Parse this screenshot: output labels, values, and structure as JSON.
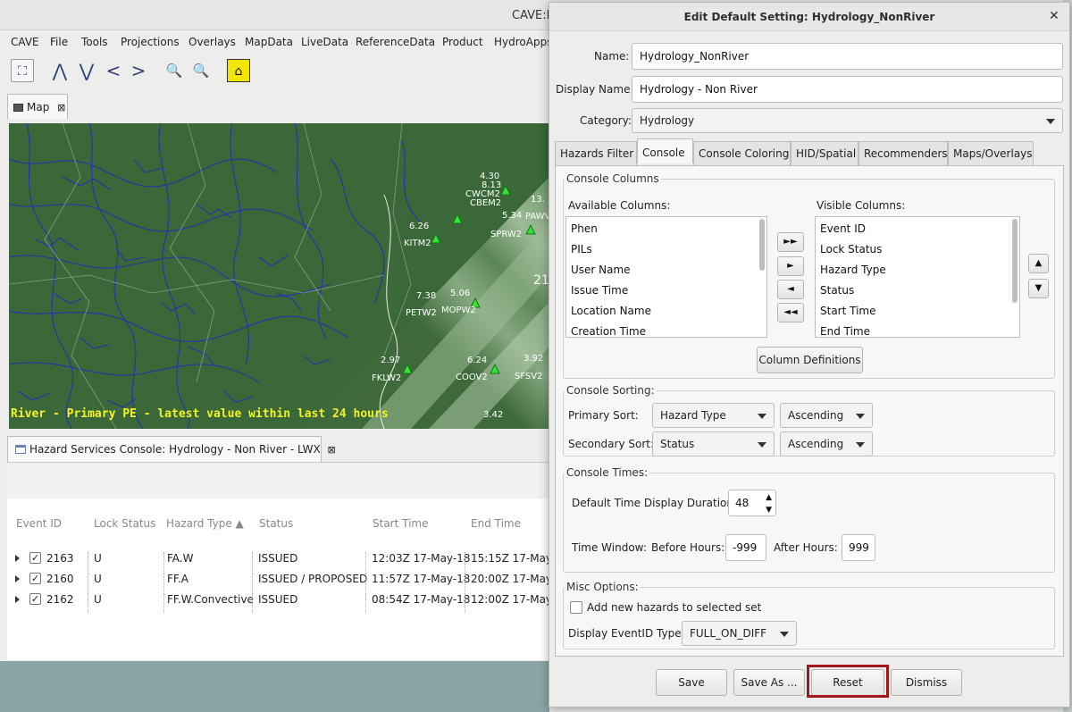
{
  "cave": {
    "window_title": "CAVE:L",
    "menu": [
      "CAVE",
      "File",
      "Tools",
      "Projections",
      "Overlays",
      "MapData",
      "LiveData",
      "ReferenceData",
      "Product",
      "HydroApps"
    ],
    "map_tab": "Map",
    "map_caption": "River - Primary PE - latest value within last 24 hours",
    "stations": [
      {
        "name": "CWCM2",
        "value": "4.30"
      },
      {
        "name": "CBEM2",
        "value": "8.13"
      },
      {
        "name": "PAWV",
        "value": "13."
      },
      {
        "name": "SPRW2",
        "value": "5.34"
      },
      {
        "name": "KITM2",
        "value": "6.26"
      },
      {
        "name": "PETW2",
        "value": "7.38"
      },
      {
        "name": "MOPW2",
        "value": "5.06"
      },
      {
        "name": "FKLW2",
        "value": "2.97"
      },
      {
        "name": "COOV2",
        "value": "6.24"
      },
      {
        "name": "SFSV2",
        "value": "3.92"
      }
    ],
    "extra_values": [
      "3.42",
      "21"
    ],
    "console_tab": "Hazard Services Console: Hydrology - Non River - LWX",
    "console_columns": [
      "Event ID",
      "Lock Status",
      "Hazard Type ▲",
      "Status",
      "Start Time",
      "End Time"
    ],
    "console_rows": [
      {
        "event_id": "2163",
        "lock": "U",
        "hazard_type": "FA.W",
        "status": "ISSUED",
        "start": "12:03Z 17-May-18",
        "end": "15:15Z 17-May-"
      },
      {
        "event_id": "2160",
        "lock": "U",
        "hazard_type": "FF.A",
        "status": "ISSUED / PROPOSED",
        "start": "11:57Z 17-May-18",
        "end": "20:00Z 17-May-"
      },
      {
        "event_id": "2162",
        "lock": "U",
        "hazard_type": "FF.W.Convective",
        "status": "ISSUED",
        "start": "08:54Z 17-May-18",
        "end": "12:00Z 17-May-"
      }
    ]
  },
  "dialog": {
    "title": "Edit Default Setting: Hydrology_NonRiver",
    "name_label": "Name:",
    "name_value": "Hydrology_NonRiver",
    "display_name_label": "Display Name:",
    "display_name_value": "Hydrology - Non River",
    "category_label": "Category:",
    "category_value": "Hydrology",
    "tabs": [
      "Hazards Filter",
      "Console",
      "Console Coloring",
      "HID/Spatial",
      "Recommenders",
      "Maps/Overlays"
    ],
    "console_columns_group": "Console Columns",
    "available_label": "Available Columns:",
    "available_columns": [
      "Phen",
      "PILs",
      "User Name",
      "Issue Time",
      "Location Name",
      "Creation Time"
    ],
    "visible_label": "Visible Columns:",
    "visible_columns": [
      "Event ID",
      "Lock Status",
      "Hazard Type",
      "Status",
      "Start Time",
      "End Time"
    ],
    "move_buttons": [
      "►►",
      "►",
      "◄",
      "◄◄"
    ],
    "order_buttons": [
      "▲",
      "▼"
    ],
    "column_definitions": "Column Definitions",
    "sorting_group": "Console Sorting:",
    "primary_sort_label": "Primary Sort:",
    "primary_sort_value": "Hazard Type",
    "primary_order": "Ascending",
    "secondary_sort_label": "Secondary Sort:",
    "secondary_sort_value": "Status",
    "secondary_order": "Ascending",
    "times_group": "Console Times:",
    "duration_label": "Default Time Display Duration:",
    "duration_value": "48",
    "window_label": "Time Window:",
    "before_label": "Before Hours:",
    "before_value": "-999",
    "after_label": "After Hours:",
    "after_value": "999",
    "misc_group": "Misc Options:",
    "add_new_label": "Add new hazards to selected set",
    "eventid_type_label": "Display EventID Type:",
    "eventid_type_value": "FULL_ON_DIFF",
    "buttons": {
      "save": "Save",
      "save_as": "Save As ...",
      "reset": "Reset",
      "dismiss": "Dismiss"
    }
  }
}
